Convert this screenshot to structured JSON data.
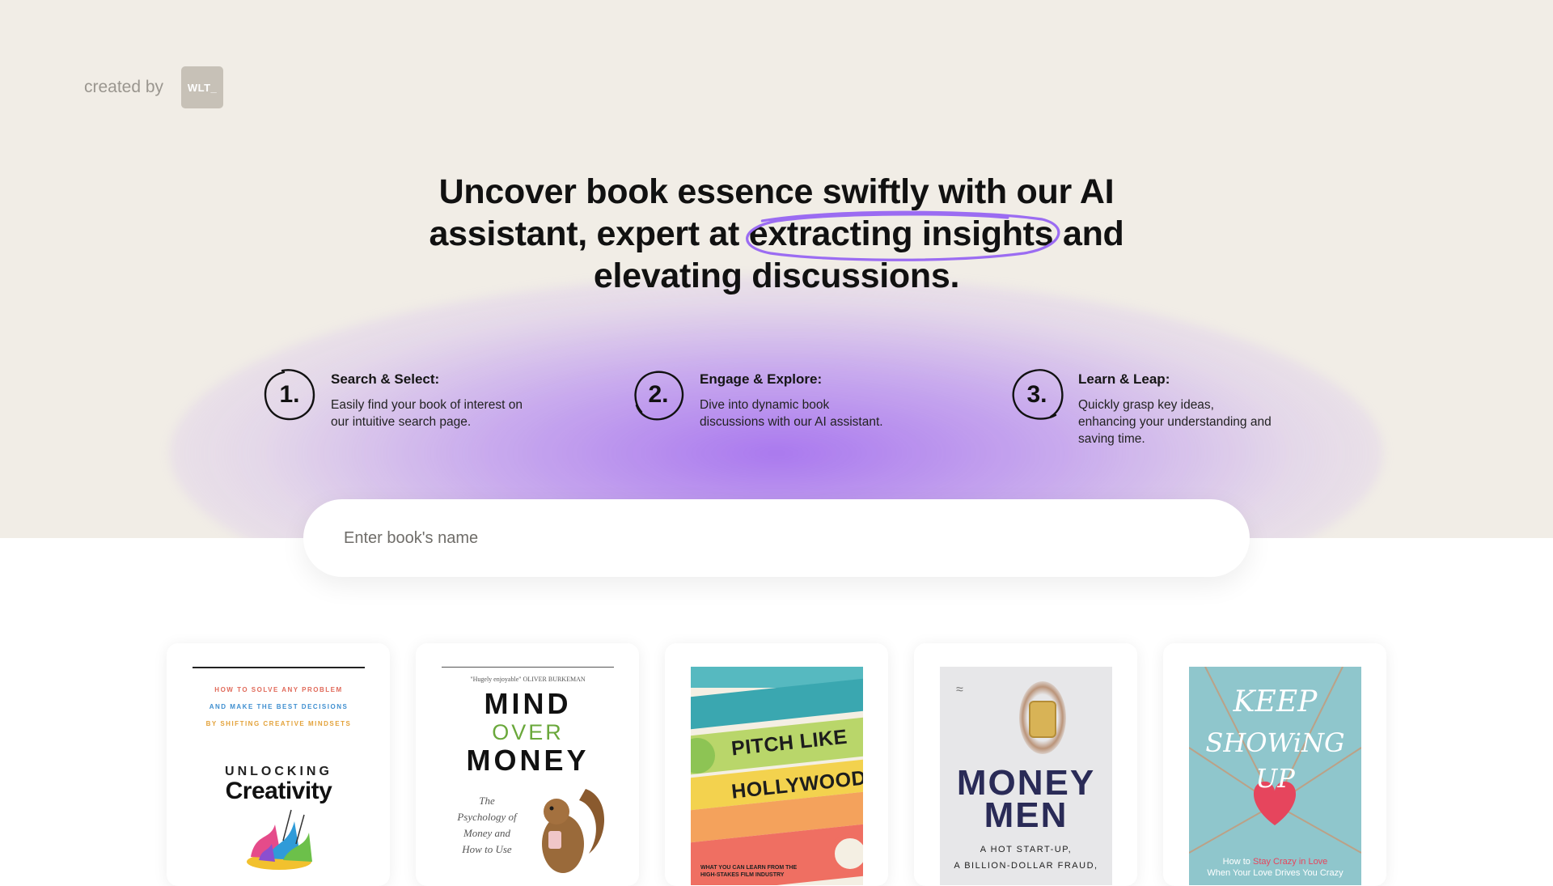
{
  "credit": {
    "label": "created by",
    "logo_text": "WLT_"
  },
  "headline": {
    "before": "Uncover book essence swiftly with our AI assistant, expert at ",
    "highlight": "extracting insights",
    "after": " and elevating discussions.",
    "highlight_color": "#9b6cf2"
  },
  "steps": [
    {
      "number": "1.",
      "title": "Search & Select:",
      "description": "Easily find your book of interest on our intuitive search page."
    },
    {
      "number": "2.",
      "title": "Engage & Explore:",
      "description": "Dive into dynamic book discussions with our AI assistant."
    },
    {
      "number": "3.",
      "title": "Learn & Leap:",
      "description": "Quickly grasp key ideas, enhancing your understanding and saving time."
    }
  ],
  "search": {
    "placeholder": "Enter book's name",
    "value": ""
  },
  "books": [
    {
      "cover_lines": [
        "HOW TO SOLVE ANY PROBLEM",
        "AND MAKE THE BEST DECISIONS",
        "BY SHIFTING CREATIVE MINDSETS",
        "UNLOCKING",
        "Creativity"
      ]
    },
    {
      "cover_lines": [
        "\"Hugely enjoyable\" OLIVER BURKEMAN",
        "MIND",
        "OVER",
        "MONEY",
        "The Psychology of Money and How to Use"
      ]
    },
    {
      "cover_lines": [
        "PITCH LIKE",
        "HOLLYWOOD",
        "WHAT YOU CAN LEARN FROM THE HIGH-STAKES FILM INDUSTRY"
      ]
    },
    {
      "cover_lines": [
        "MONEY",
        "MEN",
        "A HOT START-UP,",
        "A BILLION-DOLLAR FRAUD,"
      ]
    },
    {
      "cover_lines": [
        "KEEP",
        "SHOWiNG UP",
        "How to",
        "Stay Crazy in Love",
        "When Your Love Drives You Crazy"
      ]
    }
  ],
  "colors": {
    "hero_background": "#f1ede6",
    "glow": "#a470f0",
    "accent": "#9b6cf2"
  }
}
